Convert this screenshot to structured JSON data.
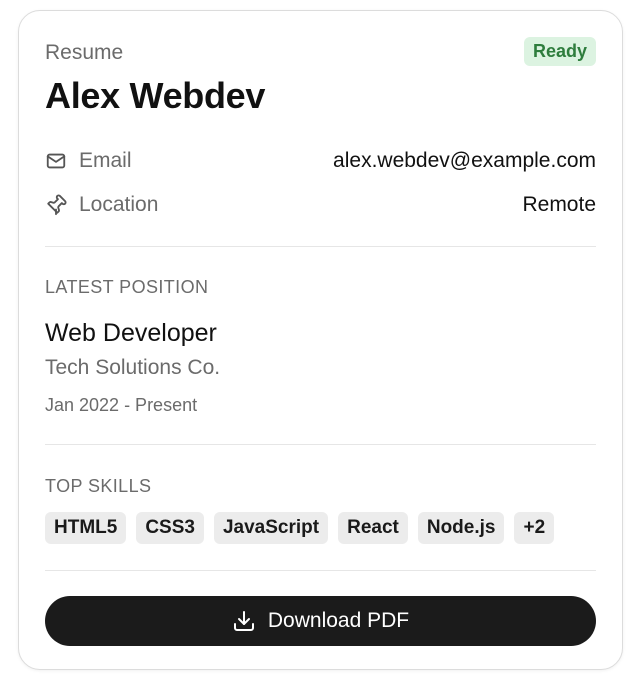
{
  "header": {
    "label": "Resume",
    "status": "Ready",
    "name": "Alex Webdev"
  },
  "colors": {
    "status_bg": "#dcf3e1",
    "status_text": "#2e7d3d",
    "button_bg": "#1b1b1b"
  },
  "contact": {
    "email_label": "Email",
    "email_value": "alex.webdev@example.com",
    "email_icon": "mail-icon",
    "location_label": "Location",
    "location_value": "Remote",
    "location_icon": "pin-icon"
  },
  "latest_position": {
    "section_title": "LATEST POSITION",
    "title": "Web Developer",
    "company": "Tech Solutions Co.",
    "dates": "Jan 2022 - Present"
  },
  "skills": {
    "section_title": "TOP SKILLS",
    "items": [
      "HTML5",
      "CSS3",
      "JavaScript",
      "React",
      "Node.js",
      "+2"
    ]
  },
  "actions": {
    "download_label": "Download PDF",
    "download_icon": "download-icon"
  }
}
